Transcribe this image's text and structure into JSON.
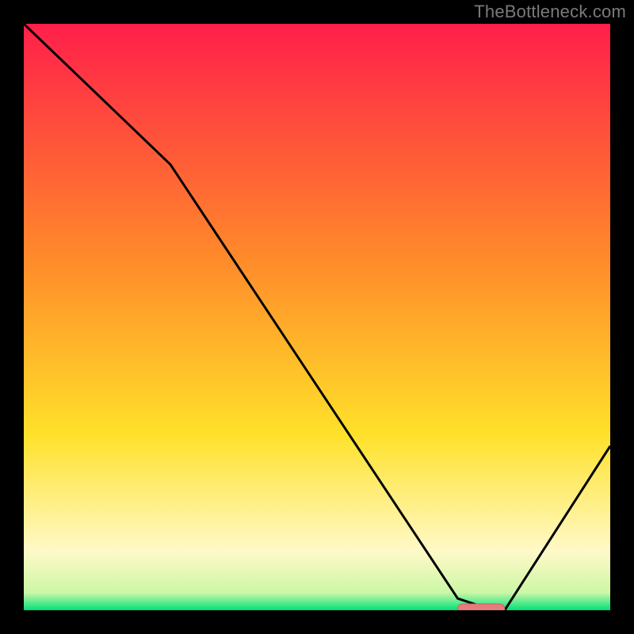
{
  "watermark": "TheBottleneck.com",
  "colors": {
    "bg": "#000000",
    "grad_top": "#ff1f4a",
    "grad_mid1": "#ff8a2a",
    "grad_mid2": "#ffe12a",
    "grad_low": "#fff9c8",
    "grad_base": "#00e07a",
    "curve": "#000000",
    "marker_fill": "#e77b7b",
    "marker_stroke": "#d26060"
  },
  "chart_data": {
    "type": "line",
    "title": "",
    "xlabel": "",
    "ylabel": "",
    "xlim": [
      0,
      100
    ],
    "ylim": [
      0,
      100
    ],
    "x": [
      0,
      25,
      74,
      80,
      82,
      100
    ],
    "values": [
      100,
      76,
      2,
      0,
      0,
      28
    ],
    "marker": {
      "x_start": 74,
      "x_end": 82,
      "y": 0
    },
    "gradient_stops": [
      {
        "offset": 0.0,
        "color": "#ff1f4a"
      },
      {
        "offset": 0.4,
        "color": "#ff8a2a"
      },
      {
        "offset": 0.7,
        "color": "#ffe12a"
      },
      {
        "offset": 0.9,
        "color": "#fff9c8"
      },
      {
        "offset": 0.97,
        "color": "#ccf7a6"
      },
      {
        "offset": 1.0,
        "color": "#00e07a"
      }
    ]
  }
}
